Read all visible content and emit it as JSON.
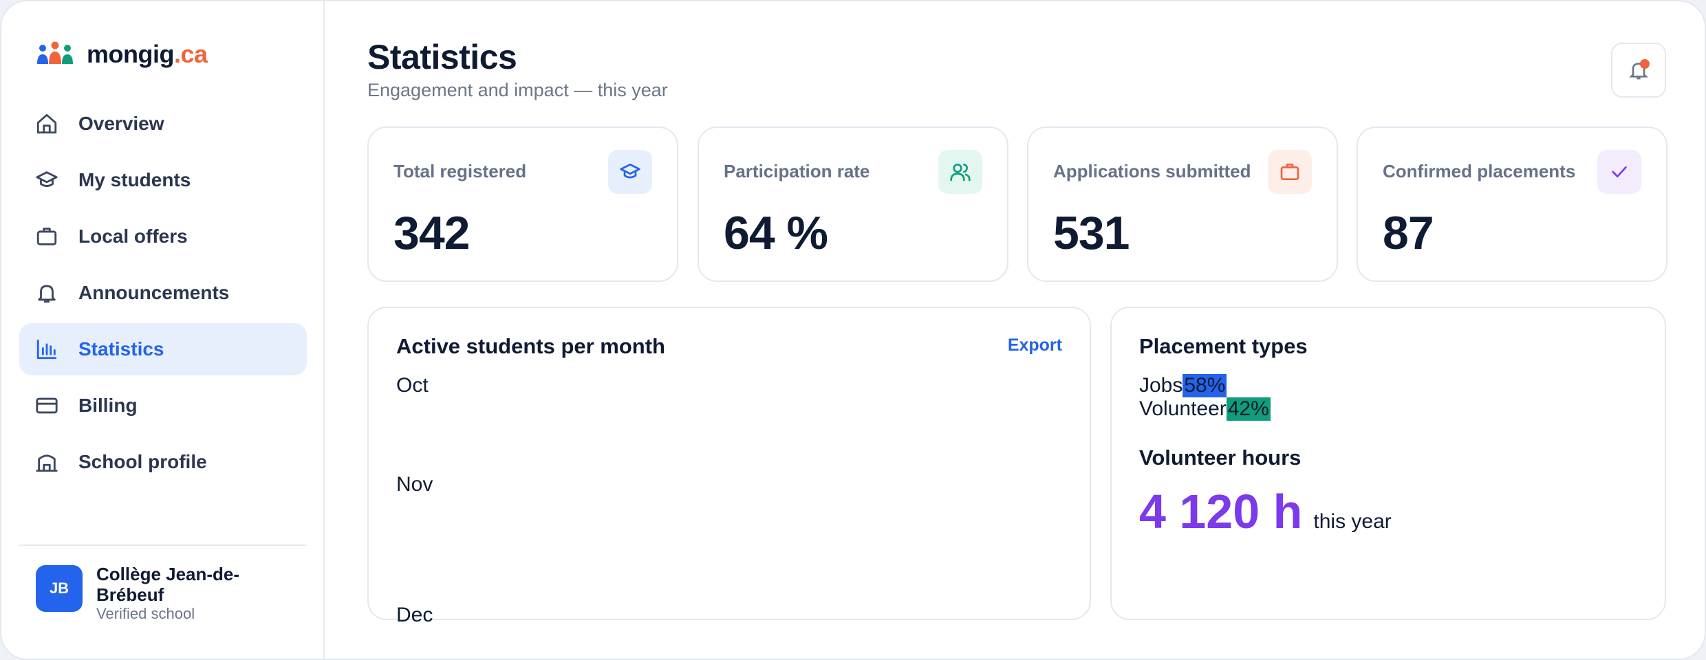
{
  "brand": {
    "name": "mongig",
    "tld": ".ca"
  },
  "sidebar": {
    "items": [
      {
        "label": "Overview",
        "icon": "home-icon"
      },
      {
        "label": "My students",
        "icon": "graduation-cap-icon"
      },
      {
        "label": "Local offers",
        "icon": "briefcase-icon"
      },
      {
        "label": "Announcements",
        "icon": "bell-icon"
      },
      {
        "label": "Statistics",
        "icon": "bar-chart-icon",
        "active": true
      },
      {
        "label": "Billing",
        "icon": "credit-card-icon"
      },
      {
        "label": "School profile",
        "icon": "school-building-icon"
      }
    ],
    "school": {
      "initials": "JB",
      "name": "Collège Jean-de-Brébeuf",
      "status": "Verified school"
    }
  },
  "header": {
    "title": "Statistics",
    "subtitle": "Engagement and impact — this year"
  },
  "stats": [
    {
      "label": "Total registered",
      "value": "342",
      "icon": "graduation-cap-icon",
      "color": "#2463eb",
      "bg": "#e7effd"
    },
    {
      "label": "Participation rate",
      "value": "64 %",
      "icon": "users-icon",
      "color": "#0f9d7a",
      "bg": "#e3f6f0"
    },
    {
      "label": "Applications submitted",
      "value": "531",
      "icon": "briefcase-icon",
      "color": "#f0643c",
      "bg": "#fdeee8"
    },
    {
      "label": "Confirmed placements",
      "value": "87",
      "icon": "check-icon",
      "color": "#7c3aed",
      "bg": "#f2ecfd"
    }
  ],
  "active_panel": {
    "title": "Active students per month",
    "export_label": "Export",
    "months": [
      "Oct",
      "Nov",
      "Dec"
    ]
  },
  "placement_panel": {
    "title": "Placement types",
    "types": [
      {
        "label": "Jobs",
        "pct": "58%",
        "color": "#2463eb"
      },
      {
        "label": "Volunteer",
        "pct": "42%",
        "color": "#0f9d7a"
      }
    ],
    "volunteer_title": "Volunteer hours",
    "volunteer_value": "4 120 h",
    "volunteer_unit": "this year"
  },
  "colors": {
    "accent": "#2463eb",
    "brand_orange": "#f0643c",
    "purple": "#7c3aed",
    "green": "#0f9d7a"
  }
}
